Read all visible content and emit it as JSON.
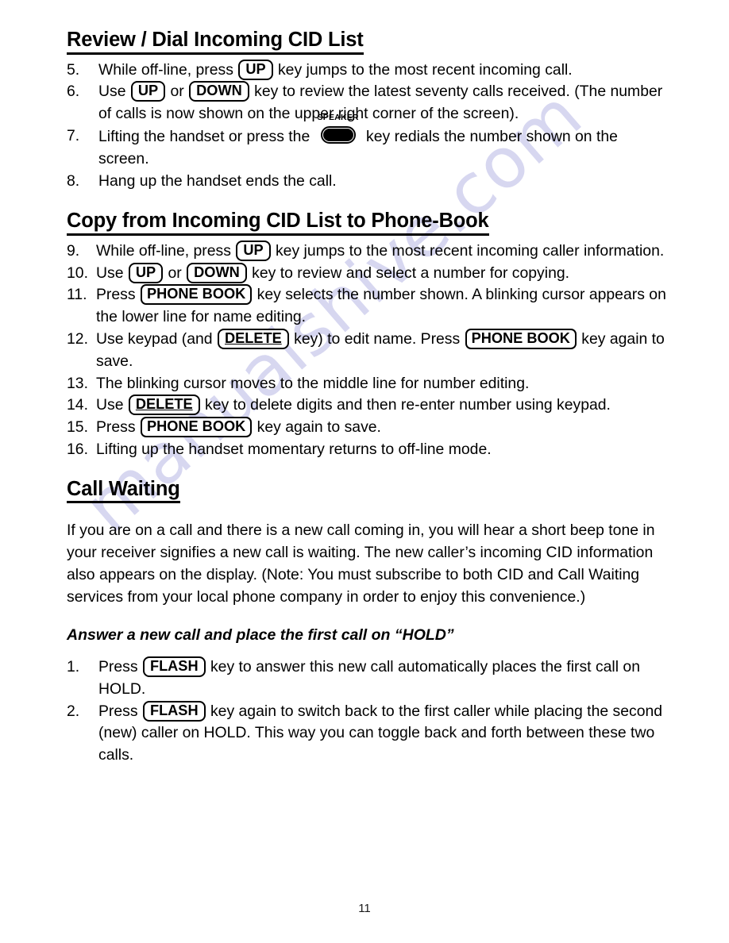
{
  "document": {
    "page_number": "11",
    "watermark": "manualshive.com",
    "watermark_color": "#bfbfe8"
  },
  "sections": [
    {
      "id": "review-dial",
      "heading": "Review / Dial Incoming CID List",
      "steps": [
        {
          "num": "5.",
          "parts": [
            {
              "type": "text",
              "text": "While off-line, press "
            },
            {
              "type": "key",
              "label": "UP"
            },
            {
              "type": "text",
              "text": " key jumps to the most recent incoming call."
            }
          ]
        },
        {
          "num": "6.",
          "parts": [
            {
              "type": "text",
              "text": "Use "
            },
            {
              "type": "key",
              "label": "UP"
            },
            {
              "type": "text",
              "text": " or "
            },
            {
              "type": "key",
              "label": "DOWN"
            },
            {
              "type": "text",
              "text": " key to review the latest seventy calls received. (The   number of calls is now shown on the upper right corner of the screen)."
            }
          ]
        },
        {
          "num": "7.",
          "parts": [
            {
              "type": "text",
              "text": "Lifting the handset or press the "
            },
            {
              "type": "speaker-key",
              "label": "SPEAKER"
            },
            {
              "type": "text",
              "text": " key redials the number shown on the screen."
            }
          ]
        },
        {
          "num": "8.",
          "parts": [
            {
              "type": "text",
              "text": "Hang up the handset ends the call."
            }
          ]
        }
      ]
    },
    {
      "id": "copy-to-phonebook",
      "heading": "Copy from Incoming CID List to Phone-Book",
      "steps": [
        {
          "num": "9.",
          "parts": [
            {
              "type": "text",
              "text": "While off-line, press "
            },
            {
              "type": "key",
              "label": "UP"
            },
            {
              "type": "text",
              "text": " key jumps to the most recent incoming caller information."
            }
          ]
        },
        {
          "num": "10.",
          "parts": [
            {
              "type": "text",
              "text": "Use "
            },
            {
              "type": "key",
              "label": "UP"
            },
            {
              "type": "text",
              "text": " or "
            },
            {
              "type": "key",
              "label": "DOWN"
            },
            {
              "type": "text",
              "text": " key to review and select a number for copying."
            }
          ]
        },
        {
          "num": "11.",
          "parts": [
            {
              "type": "text",
              "text": "Press "
            },
            {
              "type": "key",
              "label": "PHONE BOOK"
            },
            {
              "type": "text",
              "text": " key selects the number shown.   A blinking cursor appears on the lower line for name editing."
            }
          ]
        },
        {
          "num": "12.",
          "parts": [
            {
              "type": "text",
              "text": "Use keypad (and "
            },
            {
              "type": "key",
              "label": "DELETE",
              "underline": true
            },
            {
              "type": "text",
              "text": " key) to edit name. Press "
            },
            {
              "type": "key",
              "label": "PHONE BOOK"
            },
            {
              "type": "text",
              "text": " key again to save."
            }
          ]
        },
        {
          "num": "13.",
          "parts": [
            {
              "type": "text",
              "text": "The blinking cursor moves to the middle line for number editing."
            }
          ]
        },
        {
          "num": "14.",
          "parts": [
            {
              "type": "text",
              "text": "Use "
            },
            {
              "type": "key",
              "label": "DELETE",
              "underline": true
            },
            {
              "type": "text",
              "text": " key to delete digits and then re-enter number using keypad."
            }
          ]
        },
        {
          "num": "15.",
          "parts": [
            {
              "type": "text",
              "text": "Press "
            },
            {
              "type": "key",
              "label": "PHONE BOOK"
            },
            {
              "type": "text",
              "text": " key again to save."
            }
          ]
        },
        {
          "num": "16.",
          "parts": [
            {
              "type": "text",
              "text": "Lifting up the handset momentary returns to off-line mode."
            }
          ]
        }
      ]
    },
    {
      "id": "call-waiting",
      "heading": "Call Waiting",
      "paragraph": "If you are on a call and there is a new call coming in, you will hear a short beep tone in your receiver signifies a new call is waiting.   The new caller’s incoming CID information also appears on the display.    (Note:   You must subscribe to both CID and Call Waiting services from your local phone company in order to enjoy this convenience.)",
      "sub_heading": "Answer a new call and place the first call on “HOLD”",
      "steps": [
        {
          "num": "1.",
          "parts": [
            {
              "type": "text",
              "text": "Press "
            },
            {
              "type": "key",
              "label": "FLASH"
            },
            {
              "type": "text",
              "text": " key to answer this new call automatically places the first call on HOLD."
            }
          ]
        },
        {
          "num": "2.",
          "parts": [
            {
              "type": "text",
              "text": "Press "
            },
            {
              "type": "key",
              "label": "FLASH"
            },
            {
              "type": "text",
              "text": " key again to switch back to the first caller while placing the second (new) caller on HOLD.   This way you can toggle back and forth between these two calls."
            }
          ]
        }
      ]
    }
  ]
}
